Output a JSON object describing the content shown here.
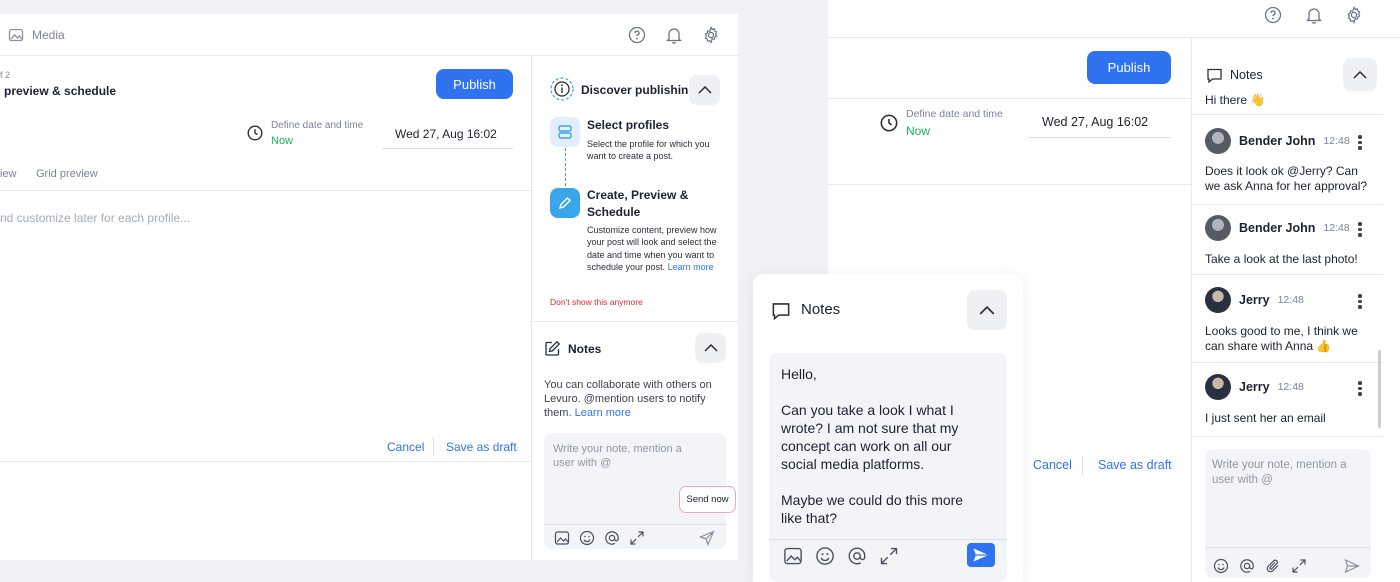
{
  "left": {
    "media_label": "Media",
    "step_label": "f 2",
    "step_title": "preview & schedule",
    "publish_label": "Publish",
    "define_label": "Define date and time",
    "now_label": "Now",
    "date_value": "Wed 27, Aug 16:02",
    "tab_view": "iew",
    "tab_grid": "Grid preview",
    "editor_placeholder": "nd customize later for each profile...",
    "cancel_label": "Cancel",
    "draft_label": "Save as draft",
    "discover": {
      "title": "Discover publishing",
      "step1_title": "Select profiles",
      "step1_desc": "Select the profile for which you want to create a post.",
      "step2_title": "Create, Preview & Schedule",
      "step2_desc": "Customize content, preview how your post will look and select the date and time when you want to schedule your post.",
      "learn_more": "Learn more",
      "dont_show": "Don't show this anymore"
    },
    "notes": {
      "title": "Notes",
      "info": "You can collaborate with others on Levuro. @mention users to notify them.",
      "learn_more": "Learn more",
      "placeholder": "Write your note, mention a user with @",
      "tooltip": "Send now"
    }
  },
  "right": {
    "publish_label": "Publish",
    "define_label": "Define date and time",
    "now_label": "Now",
    "date_value": "Wed 27, Aug 16:02",
    "cancel_label": "Cancel",
    "draft_label": "Save as draft",
    "notes": {
      "title": "Notes",
      "greeting": "Hi there 👋",
      "messages": [
        {
          "author": "Bender John",
          "time": "12:48",
          "text": "Does it look ok @Jerry? Can we ask Anna for her approval?"
        },
        {
          "author": "Bender John",
          "time": "12:48",
          "text": "Take a look at the last photo!"
        },
        {
          "author": "Jerry",
          "time": "12:48",
          "text": "Looks good to me, I think we can share with Anna 👍"
        },
        {
          "author": "Jerry",
          "time": "12:48",
          "text": "I just sent her an email"
        }
      ],
      "placeholder": "Write your note, mention a user with @"
    }
  },
  "popup": {
    "title": "Notes",
    "message_lines": [
      "Hello,",
      "",
      "Can you take a look I what I wrote? I am not sure that my concept can work on all our social media platforms.",
      "",
      "Maybe we could do this more like that?"
    ]
  },
  "colors": {
    "accent": "#2f73f0",
    "now": "#1db45a",
    "warning": "#d92c2c"
  }
}
